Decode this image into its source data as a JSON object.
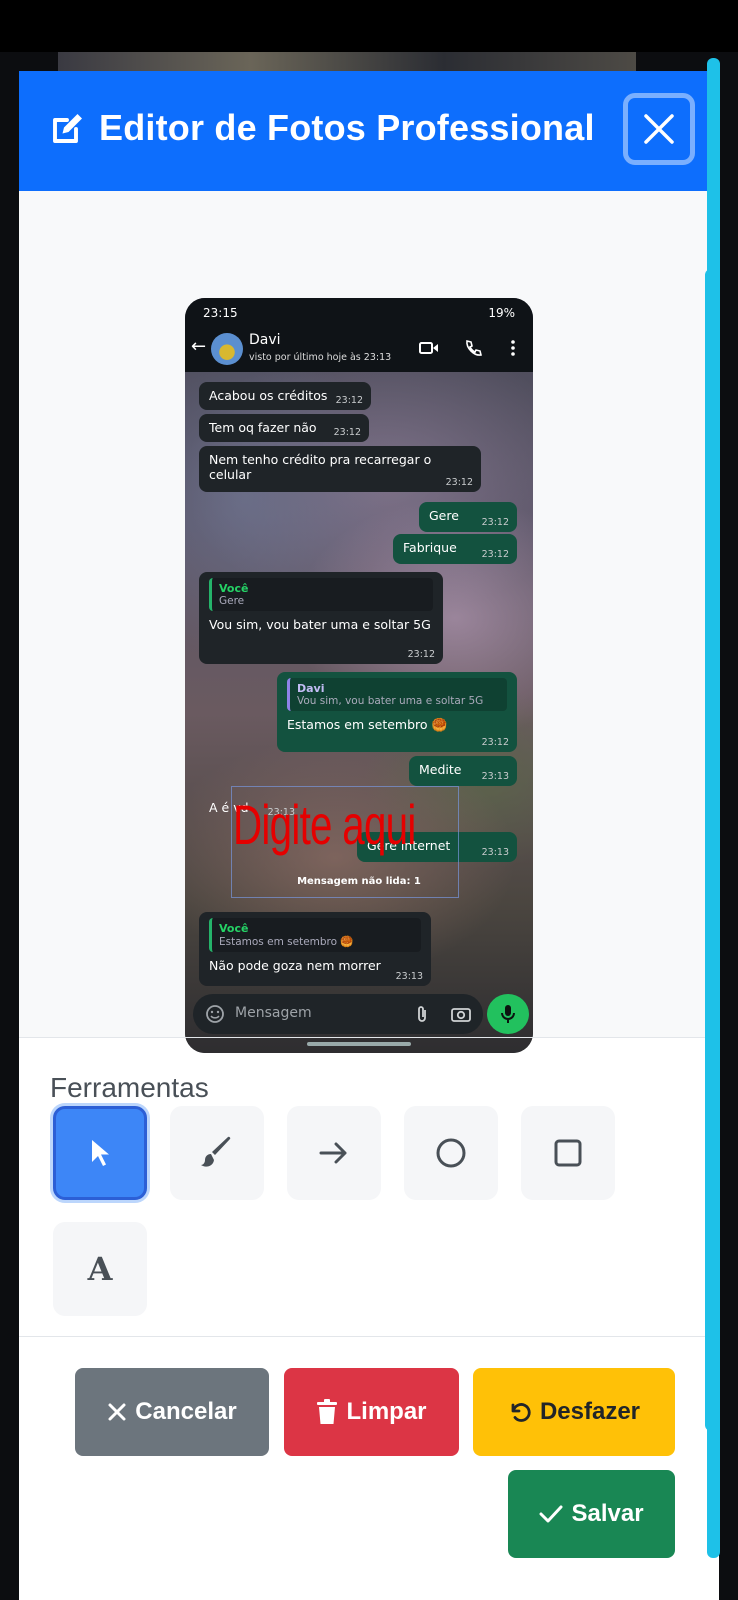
{
  "modal": {
    "title": "Editor de Fotos Professional",
    "title_icon": "pencil-square-icon",
    "close_icon": "close-icon"
  },
  "phone": {
    "status_time": "23:15",
    "status_battery": "19%",
    "contact_name": "Davi",
    "contact_status": "visto por último hoje às 23:13",
    "messages": [
      {
        "dir": "in",
        "text": "Acabou os créditos",
        "time": "23:12"
      },
      {
        "dir": "in",
        "text": "Tem oq fazer não",
        "time": "23:12"
      },
      {
        "dir": "in",
        "text": "Nem tenho crédito pra recarregar o celular",
        "time": "23:12"
      },
      {
        "dir": "out",
        "text": "Gere",
        "time": "23:12"
      },
      {
        "dir": "out",
        "text": "Fabrique",
        "time": "23:12"
      },
      {
        "dir": "in",
        "quote_author": "Você",
        "quote_text": "Gere",
        "text": "Vou sim, vou bater uma e soltar 5G",
        "time": "23:12"
      },
      {
        "dir": "out",
        "quote_author": "Davi",
        "quote_text": "Vou sim, vou bater uma e soltar 5G",
        "text": "Estamos em setembro 🥮",
        "time": "23:12"
      },
      {
        "dir": "out",
        "text": "Medite",
        "time": "23:13"
      },
      {
        "dir": "in",
        "text": "A é vd",
        "time": "23:13"
      },
      {
        "dir": "out",
        "text": "Gere internet",
        "time": "23:13"
      },
      {
        "dir": "in",
        "quote_author": "Você",
        "quote_text": "Estamos em setembro 🥮",
        "text": "Não pode goza nem morrer",
        "time": "23:13"
      }
    ],
    "unread_label": "Mensagem não lida: 1",
    "message_placeholder": "Mensagem",
    "overlay_text": "Digite aqui"
  },
  "tools": {
    "title": "Ferramentas",
    "items": [
      {
        "name": "select-tool",
        "icon": "cursor-arrow-icon",
        "active": true
      },
      {
        "name": "brush-tool",
        "icon": "brush-icon",
        "active": false
      },
      {
        "name": "arrow-tool",
        "icon": "arrow-right-icon",
        "active": false
      },
      {
        "name": "circle-tool",
        "icon": "circle-icon",
        "active": false
      },
      {
        "name": "rectangle-tool",
        "icon": "square-icon",
        "active": false
      },
      {
        "name": "text-tool",
        "icon": "text-icon",
        "active": false
      }
    ],
    "text_tool_glyph": "A"
  },
  "buttons": {
    "cancel": "Cancelar",
    "clear": "Limpar",
    "undo": "Desfazer",
    "save": "Salvar"
  },
  "colors": {
    "primary": "#0d6efd",
    "secondary": "#6c757d",
    "danger": "#dc3545",
    "warning": "#ffc107",
    "success": "#198754",
    "scrollbar": "#1ec1e8"
  }
}
